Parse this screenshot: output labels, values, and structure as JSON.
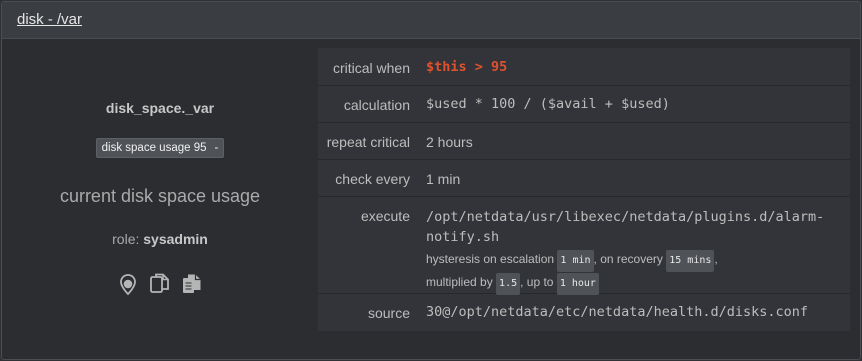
{
  "panel": {
    "title": "disk - /var"
  },
  "alarm": {
    "name": "disk_space._var",
    "badge": {
      "label": "disk space usage 95",
      "suffix": "-"
    },
    "info": "current disk space usage",
    "role_label": "role:",
    "role_value": "sysadmin"
  },
  "icons": [
    "map-pin-icon",
    "copy-icon",
    "paste-icon"
  ],
  "rows": {
    "critical": {
      "key": "critical when",
      "value": "$this > 95"
    },
    "calculation": {
      "key": "calculation",
      "value": "$used * 100 / ($avail + $used)"
    },
    "repeat": {
      "key": "repeat critical",
      "value": "2 hours"
    },
    "check": {
      "key": "check every",
      "value": "1 min"
    },
    "execute": {
      "key": "execute",
      "value_line1": "/opt/netdata/usr/libexec/netdata/plugins.d/alarm-",
      "value_line2": "notify.sh",
      "hyst_prefix": "hysteresis on escalation",
      "hyst_escalation": "1 min",
      "hyst_mid": ", on recovery",
      "hyst_recovery": "15 mins",
      "hyst_end": ",",
      "mult_prefix": "multiplied by",
      "mult_value": "1.5",
      "mult_mid": ", up to",
      "mult_max": "1 hour"
    },
    "source": {
      "key": "source",
      "value": "30@/opt/netdata/etc/netdata/health.d/disks.conf"
    }
  }
}
